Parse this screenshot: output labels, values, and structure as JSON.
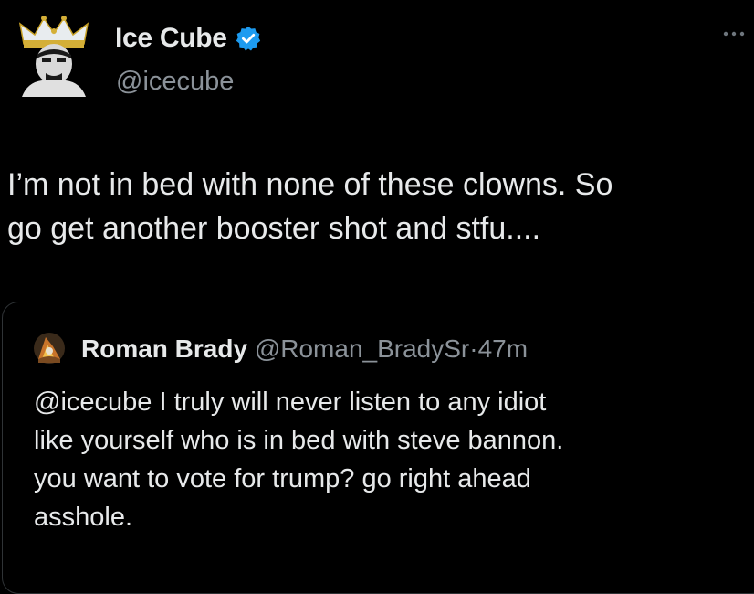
{
  "author": {
    "display_name": "Ice Cube",
    "handle": "@icecube",
    "avatar_icon": "crowned-portrait-icon",
    "verified_icon": "verified-badge-icon",
    "verified_color": "#1d9bf0"
  },
  "more_menu_icon": "more-options-icon",
  "tweet": {
    "text": "I’m not in bed with none of these clowns. So\ngo get another booster shot and stfu...."
  },
  "quoted_tweet": {
    "display_name": "Roman Brady",
    "handle": "@Roman_BradySr",
    "separator": "·",
    "timestamp": "47m",
    "avatar_icon": "wizard-avatar-icon",
    "text": "@icecube I truly will never listen to any idiot\nlike yourself who is in bed with steve bannon.\nyou want to vote for trump? go right ahead\nasshole."
  },
  "colors": {
    "background": "#000000",
    "primary_text": "#e7e9ea",
    "secondary_text": "#8b9299",
    "border": "#2f3336"
  }
}
